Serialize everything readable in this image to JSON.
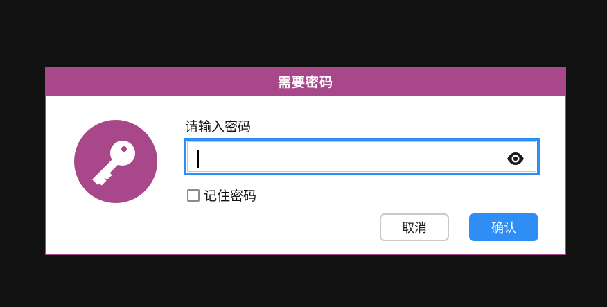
{
  "dialog": {
    "title": "需要密码",
    "prompt": "请输入密码",
    "password_value": "",
    "show_password_icon": "eye-icon",
    "remember_label": "记住密码",
    "remember_checked": false,
    "cancel_label": "取消",
    "confirm_label": "确认",
    "icon": "key-icon"
  },
  "colors": {
    "accent": "#a8488a",
    "primary": "#2e8ef5",
    "backdrop": "#111111"
  }
}
